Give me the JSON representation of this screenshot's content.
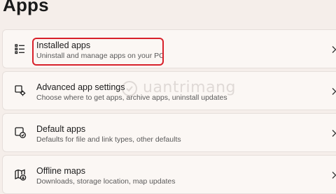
{
  "page": {
    "title": "Apps"
  },
  "items": [
    {
      "label": "Installed apps",
      "description": "Uninstall and manage apps on your PC",
      "icon": "installed-apps-list-icon"
    },
    {
      "label": "Advanced app settings",
      "description": "Choose where to get apps, archive apps, uninstall updates",
      "icon": "advanced-app-settings-gear-icon"
    },
    {
      "label": "Default apps",
      "description": "Defaults for file and link types, other defaults",
      "icon": "default-apps-check-icon"
    },
    {
      "label": "Offline maps",
      "description": "Downloads, storage location, map updates",
      "icon": "offline-maps-download-icon"
    }
  ],
  "watermark": {
    "text": "uantrimang"
  },
  "colors": {
    "background": "#f5eeea",
    "card": "#fbf7f4",
    "highlight": "#d8212b"
  }
}
